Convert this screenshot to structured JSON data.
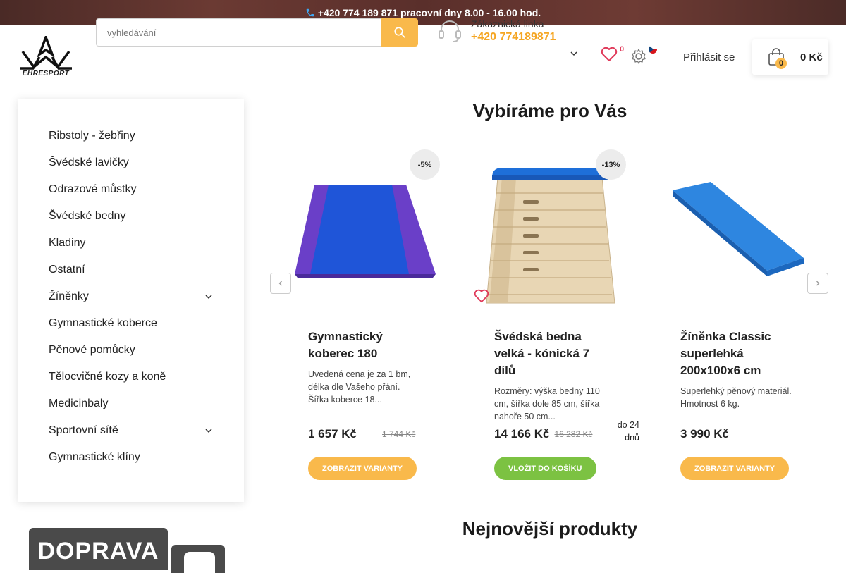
{
  "topbar": {
    "text": "+420 774 189 871 pracovní dny 8.00 - 16.00 hod."
  },
  "logo": {
    "text": "EHRESPORT"
  },
  "search": {
    "placeholder": "vyhledávání"
  },
  "support": {
    "label": "Zákaznická linka",
    "phone": "+420 774189871"
  },
  "wishlist": {
    "count": "0"
  },
  "login": {
    "label": "Přihlásit se"
  },
  "cart": {
    "count": "0",
    "total": "0 Kč"
  },
  "sidebar": {
    "items": [
      {
        "label": "Ribstoly - žebřiny",
        "expandable": false
      },
      {
        "label": "Švédské lavičky",
        "expandable": false
      },
      {
        "label": "Odrazové můstky",
        "expandable": false
      },
      {
        "label": "Švédské bedny",
        "expandable": false
      },
      {
        "label": "Kladiny",
        "expandable": false
      },
      {
        "label": "Ostatní",
        "expandable": false
      },
      {
        "label": "Žíněnky",
        "expandable": true
      },
      {
        "label": "Gymnastické koberce",
        "expandable": false
      },
      {
        "label": "Pěnové pomůcky",
        "expandable": false
      },
      {
        "label": "Tělocvičné kozy a koně",
        "expandable": false
      },
      {
        "label": "Medicinbaly",
        "expandable": false
      },
      {
        "label": "Sportovní sítě",
        "expandable": true
      },
      {
        "label": "Gymnastické klíny",
        "expandable": false
      }
    ]
  },
  "section1": {
    "title": "Vybíráme pro Vás"
  },
  "products": [
    {
      "name": "Gymnastický koberec 180",
      "desc": "Uvedená cena je za 1 bm, délka dle Vašeho přání. Šířka koberce 18...",
      "price": "1 657 Kč",
      "old_price": "1 744 Kč",
      "discount": "-5%",
      "button": "ZOBRAZIT VARIANTY",
      "button_color": "#f9b94b"
    },
    {
      "name": "Švédská bedna velká - kónická 7 dílů",
      "desc": "Rozměry: výška bedny 110 cm, šířka dole 85 cm, šířka nahoře 50 cm...",
      "price": "14 166 Kč",
      "old_price": "16 282 Kč",
      "discount": "-13%",
      "delivery": "do 24 dnů",
      "button": "VLOŽIT DO KOŠÍKU",
      "button_color": "#7cc242"
    },
    {
      "name": "Žíněnka Classic superlehká 200x100x6 cm",
      "desc": "Superlehký pěnový materiál. Hmotnost 6 kg.",
      "price": "3 990 Kč",
      "button": "ZOBRAZIT VARIANTY",
      "button_color": "#f9b94b"
    }
  ],
  "section2": {
    "title": "Nejnovější produkty"
  },
  "banner": {
    "text": "DOPRAVA"
  },
  "colors": {
    "accent": "#f9b94b",
    "green": "#7cc242",
    "heart": "#e03a5a",
    "topbar": "#5a2f2b"
  }
}
